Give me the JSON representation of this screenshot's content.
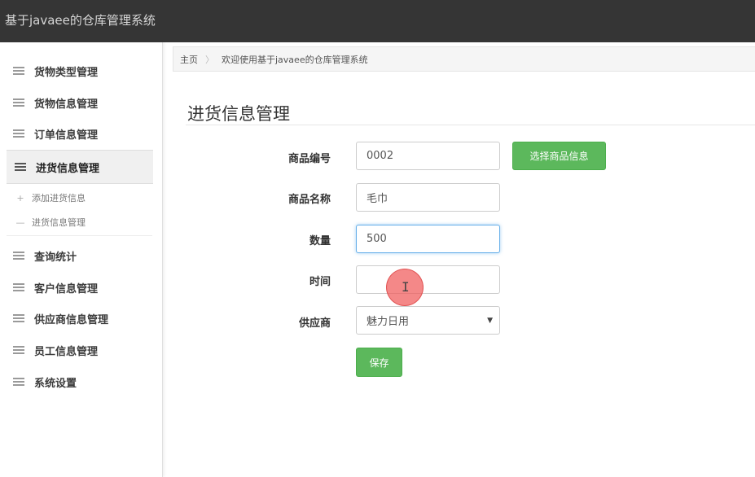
{
  "app": {
    "title": "基于javaee的仓库管理系统"
  },
  "sidebar": {
    "items": [
      {
        "label": "货物类型管理"
      },
      {
        "label": "货物信息管理"
      },
      {
        "label": "订单信息管理"
      },
      {
        "label": "进货信息管理"
      },
      {
        "label": "查询统计"
      },
      {
        "label": "客户信息管理"
      },
      {
        "label": "供应商信息管理"
      },
      {
        "label": "员工信息管理"
      },
      {
        "label": "系统设置"
      }
    ],
    "submenu": [
      {
        "symbol": "+",
        "label": "添加进货信息"
      },
      {
        "symbol": "—",
        "label": "进货信息管理"
      }
    ]
  },
  "breadcrumb": {
    "home": "主页",
    "separator": "〉",
    "current": "欢迎使用基于javaee的仓库管理系统"
  },
  "page": {
    "title": "进货信息管理"
  },
  "form": {
    "product_code": {
      "label": "商品编号",
      "value": "0002"
    },
    "select_product_button": "选择商品信息",
    "product_name": {
      "label": "商品名称",
      "value": "毛巾"
    },
    "quantity": {
      "label": "数量",
      "value": "500"
    },
    "time": {
      "label": "时间",
      "value": ""
    },
    "supplier": {
      "label": "供应商",
      "selected": "魅力日用"
    },
    "save_button": "保存"
  },
  "colors": {
    "topbar": "#353535",
    "accent_green": "#5cb85c",
    "focus_blue": "#66afe9"
  },
  "icons": {
    "menu": "hamburger-icon",
    "cursor": "text-cursor-icon",
    "dropdown": "caret-down-icon"
  }
}
